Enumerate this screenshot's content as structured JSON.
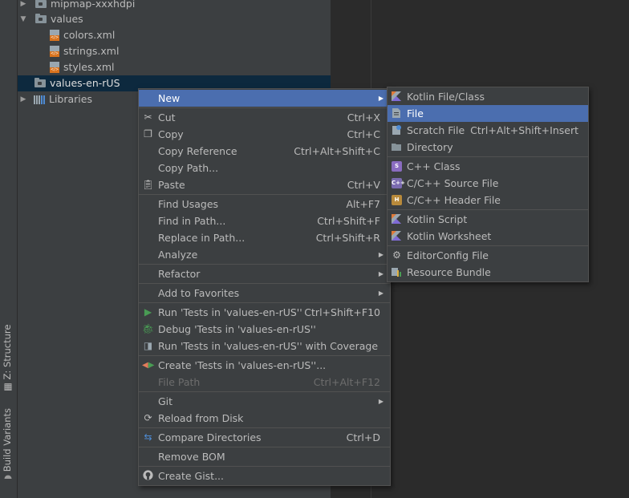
{
  "side_tabs": {
    "structure": "Z: Structure",
    "build_variants": "Build Variants"
  },
  "tree": [
    {
      "label": "mipmap-xxxhdpi",
      "type": "folder",
      "arrow": "▶"
    },
    {
      "label": "values",
      "type": "folder",
      "arrow": "▼"
    },
    {
      "label": "colors.xml",
      "type": "xml"
    },
    {
      "label": "strings.xml",
      "type": "xml"
    },
    {
      "label": "styles.xml",
      "type": "xml"
    },
    {
      "label": "values-en-rUS",
      "type": "folder",
      "arrow": ""
    },
    {
      "label": "Libraries",
      "type": "libs",
      "arrow": "▶"
    }
  ],
  "context_menu": {
    "new": "New",
    "cut": "Cut",
    "cut_sc": "Ctrl+X",
    "copy": "Copy",
    "copy_sc": "Ctrl+C",
    "copy_reference": "Copy Reference",
    "copy_reference_sc": "Ctrl+Alt+Shift+C",
    "copy_path": "Copy Path...",
    "paste": "Paste",
    "paste_sc": "Ctrl+V",
    "find_usages": "Find Usages",
    "find_usages_sc": "Alt+F7",
    "find_in_path": "Find in Path...",
    "find_in_path_sc": "Ctrl+Shift+F",
    "replace_in_path": "Replace in Path...",
    "replace_in_path_sc": "Ctrl+Shift+R",
    "analyze": "Analyze",
    "refactor": "Refactor",
    "add_to_favorites": "Add to Favorites",
    "run_tests": "Run 'Tests in 'values-en-rUS''",
    "run_tests_sc": "Ctrl+Shift+F10",
    "debug_tests": "Debug 'Tests in 'values-en-rUS''",
    "run_coverage": "Run 'Tests in 'values-en-rUS'' with Coverage",
    "create_tests": "Create 'Tests in 'values-en-rUS''...",
    "file_path": "File Path",
    "file_path_sc": "Ctrl+Alt+F12",
    "git": "Git",
    "reload": "Reload from Disk",
    "compare_dirs": "Compare Directories",
    "compare_dirs_sc": "Ctrl+D",
    "remove_bom": "Remove BOM",
    "create_gist": "Create Gist..."
  },
  "new_submenu": {
    "kotlin_file": "Kotlin File/Class",
    "file": "File",
    "scratch_file": "Scratch File",
    "scratch_file_sc": "Ctrl+Alt+Shift+Insert",
    "directory": "Directory",
    "cpp_class": "C++ Class",
    "cpp_source": "C/C++ Source File",
    "cpp_header": "C/C++ Header File",
    "kotlin_script": "Kotlin Script",
    "kotlin_worksheet": "Kotlin Worksheet",
    "editorconfig": "EditorConfig File",
    "resource_bundle": "Resource Bundle"
  },
  "colors": {
    "highlight": "#4b6eaf",
    "panel": "#3c3f41",
    "editor": "#2b2b2b",
    "selection": "#0d293e"
  }
}
